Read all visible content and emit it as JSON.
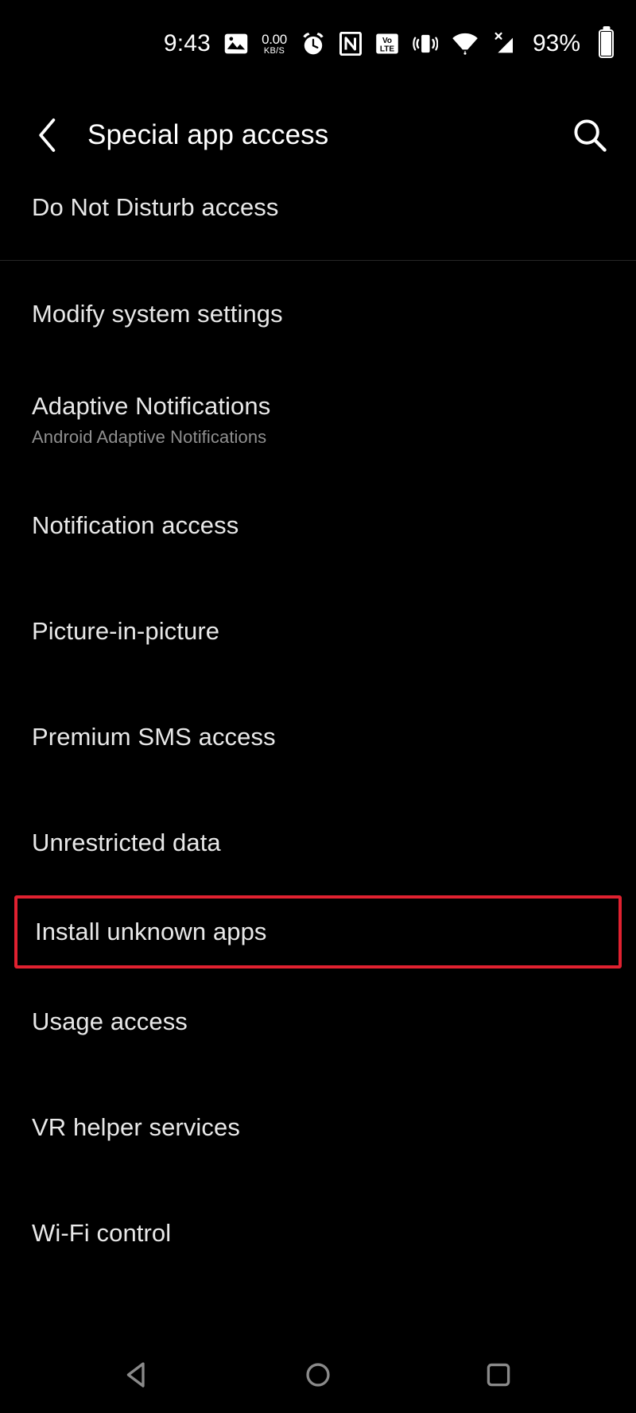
{
  "status_bar": {
    "clock": "9:43",
    "network_speed_value": "0.00",
    "network_speed_unit": "KB/S",
    "battery_percent": "93%",
    "battery_level": 93,
    "icons": [
      "screenshot-photo-icon",
      "network-speed-indicator",
      "alarm-clock-icon",
      "nfc-icon",
      "volte-icon",
      "vibrate-mode-icon",
      "wifi-icon",
      "mobile-signal-no-sim-icon",
      "battery-icon"
    ]
  },
  "app_bar": {
    "back_label": "Back",
    "title": "Special app access",
    "search_label": "Search"
  },
  "list": {
    "items": [
      {
        "title": "Do Not Disturb access",
        "subtitle": "",
        "highlighted": false,
        "clipped": true
      },
      {
        "title": "Modify system settings",
        "subtitle": "",
        "highlighted": false,
        "clipped": false
      },
      {
        "title": "Adaptive Notifications",
        "subtitle": "Android Adaptive Notifications",
        "highlighted": false,
        "clipped": false
      },
      {
        "title": "Notification access",
        "subtitle": "",
        "highlighted": false,
        "clipped": false
      },
      {
        "title": "Picture-in-picture",
        "subtitle": "",
        "highlighted": false,
        "clipped": false
      },
      {
        "title": "Premium SMS access",
        "subtitle": "",
        "highlighted": false,
        "clipped": false
      },
      {
        "title": "Unrestricted data",
        "subtitle": "",
        "highlighted": false,
        "clipped": false
      },
      {
        "title": "Install unknown apps",
        "subtitle": "",
        "highlighted": true,
        "clipped": false
      },
      {
        "title": "Usage access",
        "subtitle": "",
        "highlighted": false,
        "clipped": false
      },
      {
        "title": "VR helper services",
        "subtitle": "",
        "highlighted": false,
        "clipped": false
      },
      {
        "title": "Wi-Fi control",
        "subtitle": "",
        "highlighted": false,
        "clipped": false
      }
    ]
  },
  "nav_bar": {
    "back": "Back",
    "home": "Home",
    "recents": "Recent apps"
  },
  "colors": {
    "background": "#000000",
    "primary_text": "#e8e8e8",
    "secondary_text": "#8f8f8f",
    "divider": "#262626",
    "highlight_border": "#e02130",
    "nav_icon": "#8a8a8a"
  }
}
